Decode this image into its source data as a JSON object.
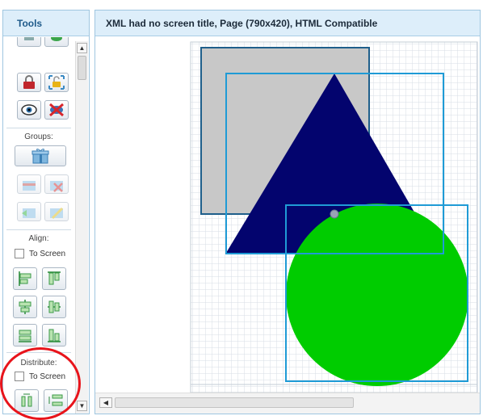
{
  "tools": {
    "title": "Tools",
    "groups_label": "Groups:",
    "align_label": "Align:",
    "align_to_screen": "To Screen",
    "distribute_label": "Distribute:",
    "distribute_to_screen": "To Screen",
    "buttons": {
      "top_row": [
        "crop-icon",
        "eye-partial-icon"
      ],
      "row_lock": [
        "lock-icon",
        "unlock-icon"
      ],
      "row_view": [
        "show-icon",
        "hide-icon"
      ],
      "group": "group-icon",
      "ungroup_row": [
        "group-add-icon",
        "group-remove-icon"
      ],
      "group_edit_row": [
        "group-select-icon",
        "group-edit-icon"
      ],
      "align_rows": [
        [
          "align-left-icon",
          "align-top-icon"
        ],
        [
          "align-center-h-icon",
          "align-center-v-icon"
        ],
        [
          "align-right-icon",
          "align-bottom-icon"
        ]
      ],
      "distribute_row": [
        "distribute-h-icon",
        "distribute-v-icon"
      ]
    }
  },
  "canvas": {
    "title": "XML had no screen title, Page (790x420), HTML Compatible"
  },
  "colors": {
    "panel_header": "#ddeefa",
    "panel_border": "#9fc6e0",
    "gray_rect": "#c8c8c8",
    "triangle": "#03046e",
    "circle": "#00cc00",
    "selection": "#1f9bd6",
    "highlight": "#e8141b"
  }
}
